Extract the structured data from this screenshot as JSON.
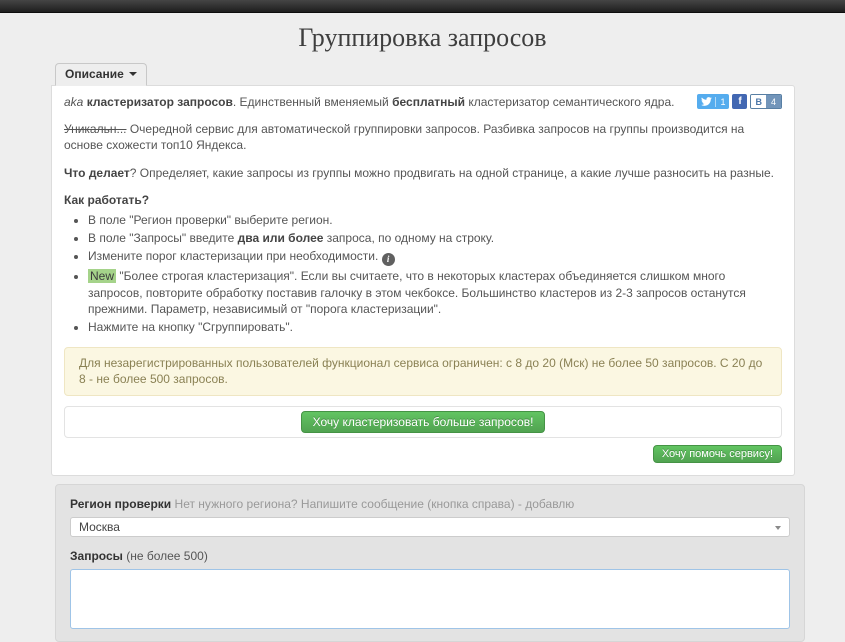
{
  "page_title": "Группировка запросов",
  "tab": {
    "label": "Описание"
  },
  "social": {
    "twitter_count": "1",
    "facebook_label": "f",
    "vk_label": "В",
    "vk_count": "4"
  },
  "intro": {
    "aka": "aka ",
    "aka_bold": "кластеризатор запросов",
    "mid": ". Единственный вменяемый ",
    "free_bold": "бесплатный",
    "tail": " кластеризатор семантического ядра."
  },
  "about": {
    "strike": "Уникальн...",
    "text": " Очередной сервис для автоматической группировки запросов. Разбивка запросов на группы производится на основе схожести топ10 Яндекса."
  },
  "what": {
    "bold": "Что делает",
    "text": "? Определяет, какие запросы из группы можно продвигать на одной странице, а какие лучше разносить на разные."
  },
  "how_title": "Как работать?",
  "steps": {
    "s1": "В поле \"Регион проверки\" выберите регион.",
    "s2_pre": "В поле \"Запросы\" введите ",
    "s2_bold": "два или более",
    "s2_post": " запроса, по одному на строку.",
    "s3": "Измените порог кластеризации при необходимости. ",
    "s3_icon": "i",
    "s4_badge": "New",
    "s4_text": " \"Более строгая кластеризация\". Если вы считаете, что в некоторых кластерах объединяется слишком много запросов, повторите обработку поставив галочку в этом чекбоксе. Большинство кластеров из 2-3 запросов останутся прежними. Параметр, независимый от \"порога кластеризации\".",
    "s5": "Нажмите на кнопку \"Сгруппировать\"."
  },
  "alert_text": "Для незарегистрированных пользователей функционал сервиса ограничен: с 8 до 20 (Мск) не более 50 запросов. С 20 до 8 - не более 500 запросов.",
  "buttons": {
    "cluster_more": "Хочу кластеризовать больше запросов!",
    "help_service": "Хочу помочь сервису!"
  },
  "form": {
    "region_label": "Регион проверки",
    "region_hint": "Нет нужного региона? Напишите сообщение (кнопка справа) - добавлю",
    "region_value": "Москва",
    "queries_label": "Запросы",
    "queries_hint": " (не более 500)"
  },
  "colors": {
    "accent_green": "#51a351",
    "twitter_blue": "#55acee",
    "facebook_blue": "#4267b2",
    "vk_blue": "#4a76a8",
    "alert_bg": "#fbf7e2",
    "highlight_green": "#a5d38a",
    "navbar_dark": "#1e1e1e"
  }
}
